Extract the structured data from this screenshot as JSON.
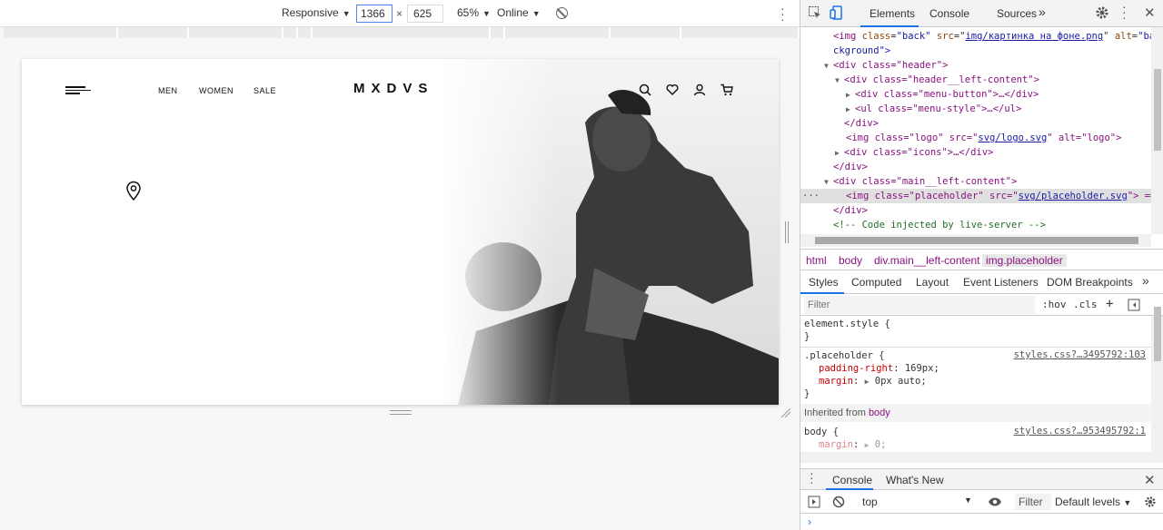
{
  "device_toolbar": {
    "mode": "Responsive",
    "width": "1366",
    "times": "×",
    "height": "625",
    "zoom": "65%",
    "network": "Online"
  },
  "site": {
    "nav": [
      "MEN",
      "WOMEN",
      "SALE"
    ],
    "logo": "MXDVS"
  },
  "devtools": {
    "tabs": [
      "Elements",
      "Console",
      "Sources"
    ],
    "more": "»",
    "dom": {
      "line0": {
        "prefix": "<",
        "tag": "img",
        "a1": "class",
        "v1": "\"back\"",
        "a2": "src",
        "v2": "img/картинка на фоне.png",
        "a3": "alt",
        "v3": "\"ba"
      },
      "line0b": "ckground\">",
      "line1": "<div class=\"header\">",
      "line2": "<div class=\"header__left-content\">",
      "line3": "<div class=\"menu-button\">…</div>",
      "line4": "<ul class=\"menu-style\">…</ul>",
      "line5": "</div>",
      "line6_pre": "<img class=\"logo\" src=\"",
      "line6_link": "svg/logo.svg",
      "line6_post": "\" alt=\"logo\">",
      "line7": "<div class=\"icons\">…</div>",
      "line8": "</div>",
      "line9": "<div class=\"main__left-content\">",
      "line10_pre": "<img class=\"placeholder\" src=\"",
      "line10_link": "svg/placeholder.svg",
      "line10_post": "\"> ==",
      "line10_dots": "···",
      "line11": "</div>",
      "line12": "<!-- Code injected by live-server -->"
    },
    "breadcrumbs": [
      "html",
      "body",
      "div.main__left-content",
      "img.placeholder"
    ],
    "styles_tabs": [
      "Styles",
      "Computed",
      "Layout",
      "Event Listeners",
      "DOM Breakpoints"
    ],
    "filter_placeholder": "Filter",
    "filter_buttons": [
      ":hov",
      ".cls",
      "+"
    ],
    "styles": {
      "element_style": "element.style {",
      "close": "}",
      "rule1_selector": ".placeholder {",
      "rule1_source": "styles.css?…3495792:103",
      "rule1_prop1": "padding-right",
      "rule1_val1": "169px;",
      "rule1_prop2": "margin",
      "rule1_val2": "0px auto;",
      "inherited_label": "Inherited from",
      "inherited_from": "body",
      "rule2_selector": "body {",
      "rule2_source": "styles.css?…953495792:1",
      "rule2_prop1": "margin",
      "rule2_val1": "0;"
    },
    "drawer_tabs": [
      "Console",
      "What's New"
    ],
    "console_context": "top",
    "console_filter": "Filter",
    "console_levels": "Default levels",
    "console_prompt": "›"
  },
  "colors": {
    "accent": "#1a73e8",
    "tag": "#881280",
    "attr": "#994500",
    "value": "#1a1aa6",
    "property": "#c80000"
  }
}
